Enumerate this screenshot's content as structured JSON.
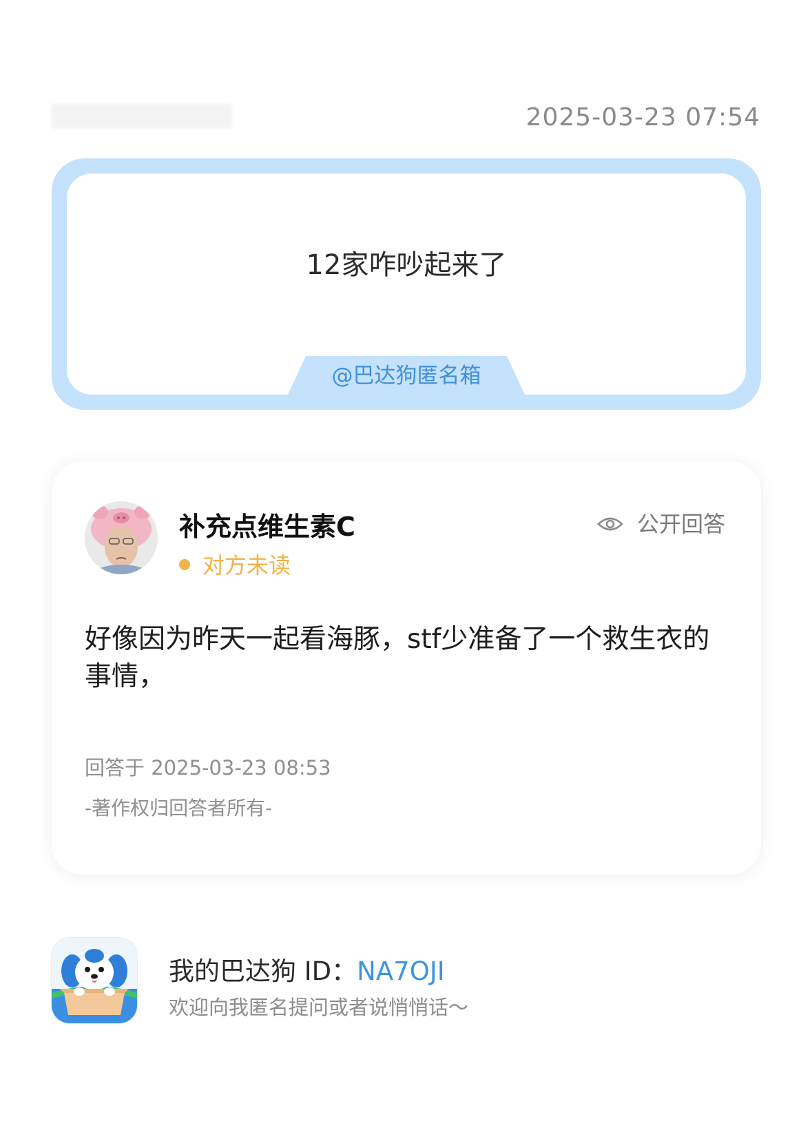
{
  "header": {
    "timestamp": "2025-03-23 07:54"
  },
  "question": {
    "text": "12家咋吵起来了",
    "tag": "@巴达狗匿名箱"
  },
  "answer": {
    "author": "补充点维生素C",
    "status": "对方未读",
    "visibility": "公开回答",
    "text": "好像因为昨天一起看海豚，stf少准备了一个救生衣的事情，",
    "answered_at": "回答于 2025-03-23 08:53",
    "copyright": "-著作权归回答者所有-"
  },
  "footer": {
    "title_prefix": "我的巴达狗 ID：",
    "user_id": "NA7OJI",
    "subtitle": "欢迎向我匿名提问或者说悄悄话～"
  },
  "colors": {
    "accent_blue": "#3d93e0",
    "frame_blue": "#c4e2fb",
    "status_orange": "#f2b24a"
  },
  "icons": {
    "visibility": "eye-icon",
    "app": "badadog-app-icon"
  }
}
